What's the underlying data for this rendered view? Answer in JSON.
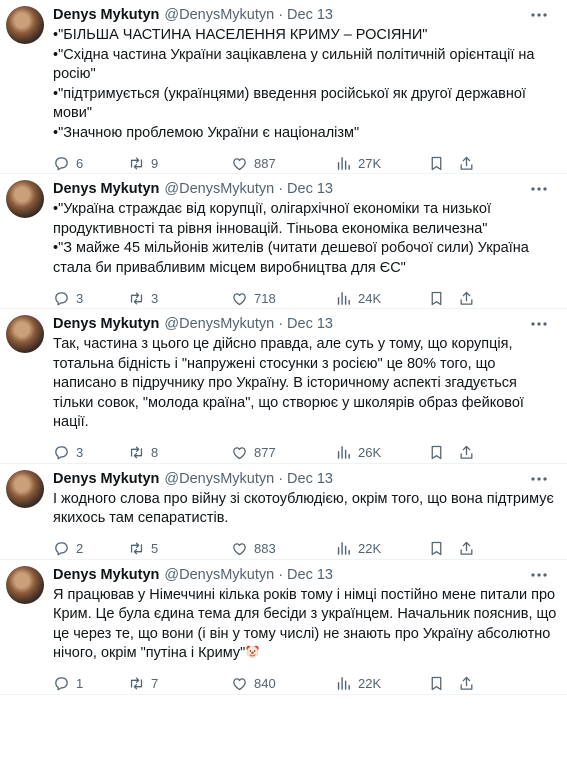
{
  "tweets": [
    {
      "name": "Denys Mykutyn",
      "handle": "@DenysMykutyn",
      "dot": "·",
      "date": "Dec 13",
      "lines": [
        "•\"БІЛЬША ЧАСТИНА НАСЕЛЕННЯ КРИМУ – РОСІЯНИ\"",
        "•\"Східна частина України зацікавлена у сильній політичній орієнтації на росію\"",
        "•\"підтримується (українцями) введення російської як другої державної мови\"",
        "•\"Значною проблемою України є націоналізм\""
      ],
      "replies": "6",
      "reposts": "9",
      "likes": "887",
      "views": "27K"
    },
    {
      "name": "Denys Mykutyn",
      "handle": "@DenysMykutyn",
      "dot": "·",
      "date": "Dec 13",
      "lines": [
        "•\"Україна страждає від корупції, олігархічної економіки та низької продуктивності та рівня інновацій. Тіньова економіка величезна\"",
        "•\"З майже 45 мільйонів жителів (читати дешевої робочої сили) Україна стала би привабливим місцем виробництва для ЄС\""
      ],
      "replies": "3",
      "reposts": "3",
      "likes": "718",
      "views": "24K"
    },
    {
      "name": "Denys Mykutyn",
      "handle": "@DenysMykutyn",
      "dot": "·",
      "date": "Dec 13",
      "lines": [
        "Так, частина з цього це дійсно правда, але суть у тому, що корупція, тотальна бідність і \"напружені стосунки з росією\" це 80% того, що написано в підручнику про Україну. В історичному аспекті згадується тільки совок, \"молода країна\", що створює у школярів образ фейкової нації."
      ],
      "replies": "3",
      "reposts": "8",
      "likes": "877",
      "views": "26K"
    },
    {
      "name": "Denys Mykutyn",
      "handle": "@DenysMykutyn",
      "dot": "·",
      "date": "Dec 13",
      "lines": [
        "І жодного слова про війну зі скотоублюдією, окрім того, що вона підтримує якихось там сепаратистів."
      ],
      "replies": "2",
      "reposts": "5",
      "likes": "883",
      "views": "22K"
    },
    {
      "name": "Denys Mykutyn",
      "handle": "@DenysMykutyn",
      "dot": "·",
      "date": "Dec 13",
      "lines": [
        "Я працював у Німеччині кілька років тому і німці постійно мене питали про Крим. Це була єдина тема для бесіди з українцем. Начальник пояснив, що це через те, що вони (і він у тому числі) не знають про Україну абсолютно нічого, окрім \"путіна і Криму\""
      ],
      "emoji": "clown-face-icon",
      "replies": "1",
      "reposts": "7",
      "likes": "840",
      "views": "22K"
    }
  ]
}
